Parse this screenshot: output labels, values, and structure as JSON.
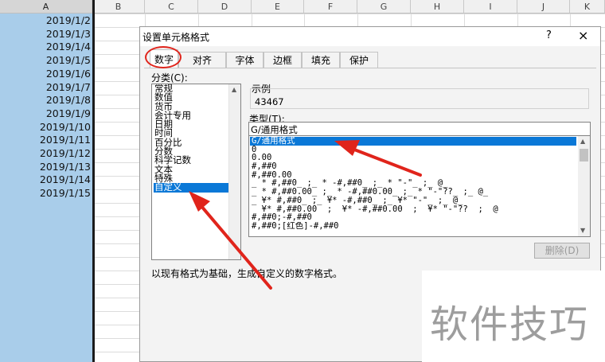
{
  "spreadsheet": {
    "columns": [
      "A",
      "B",
      "C",
      "D",
      "E",
      "F",
      "G",
      "H",
      "I",
      "J",
      "K"
    ],
    "selected_column": "A",
    "cells": [
      "2019/1/2",
      "2019/1/3",
      "2019/1/4",
      "2019/1/5",
      "2019/1/6",
      "2019/1/7",
      "2019/1/8",
      "2019/1/9",
      "2019/1/10",
      "2019/1/11",
      "2019/1/12",
      "2019/1/13",
      "2019/1/14",
      "2019/1/15"
    ]
  },
  "dialog": {
    "title": "设置单元格格式",
    "help": "?",
    "close": "×",
    "tabs": [
      "数字",
      "对齐",
      "字体",
      "边框",
      "填充",
      "保护"
    ],
    "active_tab": "数字",
    "category_label": "分类(C):",
    "categories": [
      "常规",
      "数值",
      "货币",
      "会计专用",
      "日期",
      "时间",
      "百分比",
      "分数",
      "科学记数",
      "文本",
      "特殊",
      "自定义"
    ],
    "selected_category": "自定义",
    "sample_label": "示例",
    "sample_value": "43467",
    "type_label": "类型(T):",
    "type_value": "G/通用格式",
    "formats": [
      "G/通用格式",
      "0",
      "0.00",
      "#,##0",
      "#,##0.00",
      "_ * #,##0_ ;_ * -#,##0_ ;_ * \"-\"_ ;_ @_",
      "_ * #,##0.00_ ;_ * -#,##0.00_ ;_ * \"-\"??_ ;_ @_",
      "_ ¥* #,##0_ ;_ ¥* -#,##0_ ;_ ¥* \"-\"_ ;_ @_",
      "_ ¥* #,##0.00_ ;_ ¥* -#,##0.00_ ;_ ¥* \"-\"??_ ;_ @_",
      "#,##0;-#,##0",
      "#,##0;[红色]-#,##0"
    ],
    "selected_format": "G/通用格式",
    "delete_button": "删除(D)",
    "description": "以现有格式为基础，生成自定义的数字格式。"
  },
  "watermark": "软件技巧",
  "colors": {
    "annotation": "#e0241b",
    "selection": "#0a78d7",
    "column_highlight": "#a9cdea"
  }
}
